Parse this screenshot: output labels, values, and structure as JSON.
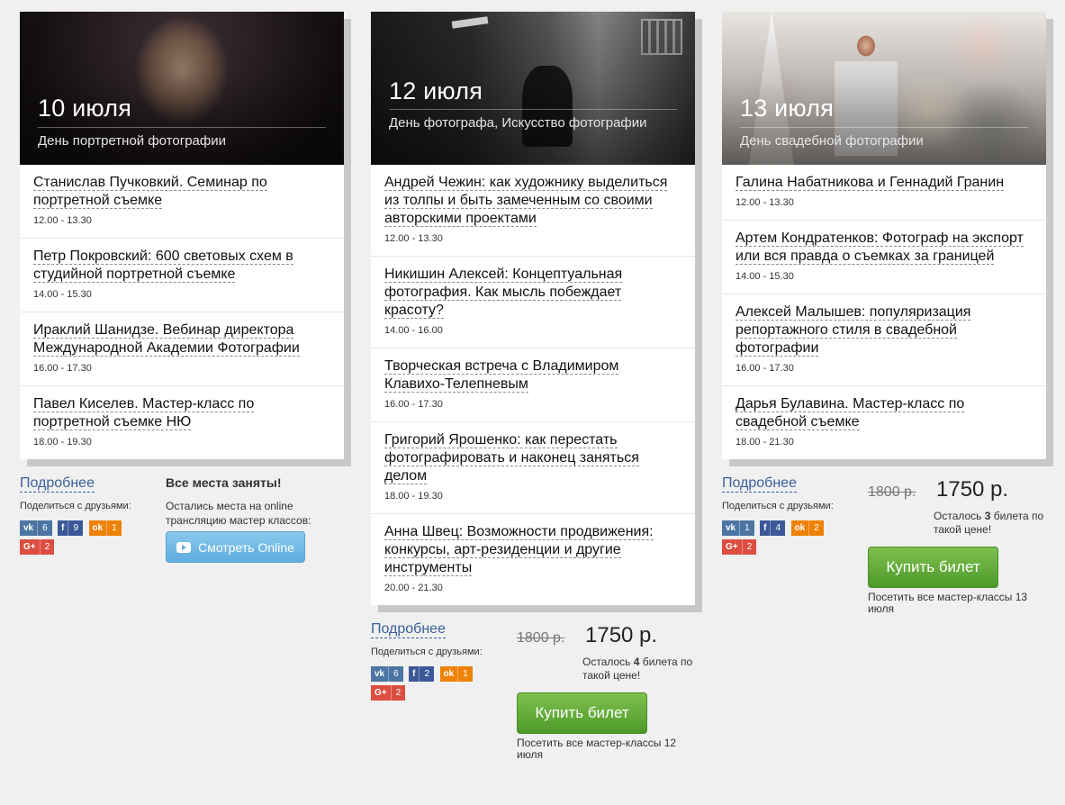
{
  "columns": [
    {
      "date": "10 июля",
      "subtitle": "День портретной фотографии",
      "events": [
        {
          "title": "Станислав Пучковкий. Семинар по портретной съемке",
          "time": "12.00 - 13.30"
        },
        {
          "title": "Петр Покровский: 600 световых схем в студийной портретной съемке",
          "time": "14.00 - 15.30"
        },
        {
          "title": "Ираклий Шанидзе. Вебинар директора Международной Академии Фотографии",
          "time": "16.00 - 17.30"
        },
        {
          "title": "Павел Киселев. Мастер-класс по портретной съемке НЮ",
          "time": "18.00 - 19.30"
        }
      ],
      "more_label": "Подробнее",
      "share_label": "Поделиться с друзьями:",
      "share": {
        "vk": "6",
        "fb": "9",
        "ok": "1",
        "gp": "2"
      },
      "sold_out_title": "Все места заняты!",
      "sold_out_text": "Остались места на online трансляцию мастер классов:",
      "online_button": "Смотреть Online"
    },
    {
      "date": "12 июля",
      "subtitle": "День фотографа, Искусство фотографии",
      "events": [
        {
          "title": "Андрей Чежин: как художнику выделиться из толпы и быть замеченным со своими авторскими проектами",
          "time": "12.00 - 13.30"
        },
        {
          "title": "Никишин Алексей: Концептуальная фотография. Как мысль побеждает красоту?",
          "time": "14.00 - 16.00"
        },
        {
          "title": "Творческая встреча с Владимиром Клавихо-Телепневым",
          "time": "16.00 - 17.30"
        },
        {
          "title": "Григорий Ярошенко: как перестать фотографировать и наконец заняться делом",
          "time": "18.00 - 19.30"
        },
        {
          "title": "Анна Швец: Возможности продвижения: конкурсы, арт-резиденции и другие инструменты",
          "time": "20.00 - 21.30"
        }
      ],
      "more_label": "Подробнее",
      "share_label": "Поделиться с друзьями:",
      "share": {
        "vk": "6",
        "fb": "2",
        "ok": "1",
        "gp": "2"
      },
      "old_price": "1800 р.",
      "new_price": "1750 р.",
      "left_before": "Осталось ",
      "left_count": "4",
      "left_after": " билета по такой цене!",
      "buy_button": "Купить билет",
      "all_classes": "Посетить все мастер-классы 12 июля"
    },
    {
      "date": "13 июля",
      "subtitle": "День свадебной фотографии",
      "events": [
        {
          "title": "Галина Набатникова и Геннадий Гранин",
          "time": "12.00 - 13.30"
        },
        {
          "title": "Артем Кондратенков: Фотограф на экспорт или вся правда о съемках за границей",
          "time": "14.00 - 15.30"
        },
        {
          "title": "Алексей Малышев: популяризация репортажного стиля в свадебной фотографии",
          "time": "16.00 - 17.30"
        },
        {
          "title": "Дарья Булавина. Мастер-класс по свадебной съемке",
          "time": "18.00 - 21.30"
        }
      ],
      "more_label": "Подробнее",
      "share_label": "Поделиться с друзьями:",
      "share": {
        "vk": "1",
        "fb": "4",
        "ok": "2",
        "gp": "2"
      },
      "old_price": "1800 р.",
      "new_price": "1750 р.",
      "left_before": "Осталось ",
      "left_count": "3",
      "left_after": " билета по такой цене!",
      "buy_button": "Купить билет",
      "all_classes": "Посетить все мастер-классы 13 июля"
    }
  ],
  "share_icons": {
    "vk": "vk-icon",
    "fb": "facebook-icon",
    "ok": "odnoklassniki-icon",
    "gp": "google-plus-icon"
  },
  "colors": {
    "link": "#3b5f9a",
    "buy": "#5fa83a",
    "online": "#6cb8e4",
    "vk": "#4c75a3",
    "fb": "#3b5998",
    "ok": "#ee8208",
    "gp": "#dc4e41"
  }
}
